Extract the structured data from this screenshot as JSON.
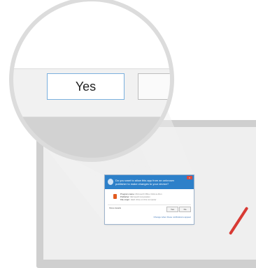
{
  "uac": {
    "question": "Do you want to allow this app from an unknown publisher to make changes to your device?",
    "rows": [
      {
        "label": "Program name:",
        "value": "Microsoft Office Click-to-Run"
      },
      {
        "label": "Publisher:",
        "value": "Microsoft Corporation"
      },
      {
        "label": "File origin:",
        "value": "Hard drive on this computer"
      }
    ],
    "show_details": "Show details",
    "yes_label": "Yes",
    "no_label": "No",
    "change_link": "Change when these notifications appear"
  },
  "magnifier": {
    "yes_label": "Yes"
  }
}
